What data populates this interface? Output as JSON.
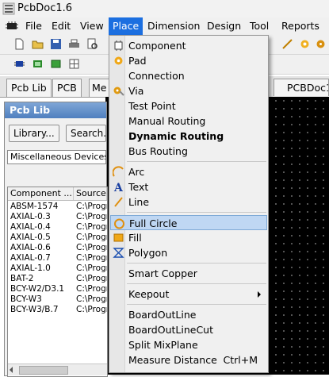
{
  "window": {
    "title": "PcbDoc1.6"
  },
  "menubar": {
    "items": [
      {
        "label": "File",
        "active": false
      },
      {
        "label": "Edit",
        "active": false
      },
      {
        "label": "View",
        "active": false
      },
      {
        "label": "Place",
        "active": true
      },
      {
        "label": "Dimension",
        "active": false
      },
      {
        "label": "Design",
        "active": false
      },
      {
        "label": "Tool",
        "active": false
      },
      {
        "label": "Reports",
        "active": false
      }
    ]
  },
  "doc_tabs": [
    {
      "label": "Pcb Lib"
    },
    {
      "label": "PCB"
    },
    {
      "label": "Me"
    }
  ],
  "editor_tab": {
    "label": "PCBDoc1"
  },
  "panel": {
    "title": "Pcb Lib",
    "library_button": "Library...",
    "search_button": "Search...",
    "library_select": "Miscellaneous Devices.pcl",
    "columns": [
      "Component ...",
      "Source"
    ],
    "rows": [
      {
        "name": "ABSM-1574",
        "source": "C:\\Progr"
      },
      {
        "name": "AXIAL-0.3",
        "source": "C:\\Progr"
      },
      {
        "name": "AXIAL-0.4",
        "source": "C:\\Progr"
      },
      {
        "name": "AXIAL-0.5",
        "source": "C:\\Progr"
      },
      {
        "name": "AXIAL-0.6",
        "source": "C:\\Progr"
      },
      {
        "name": "AXIAL-0.7",
        "source": "C:\\Progr"
      },
      {
        "name": "AXIAL-1.0",
        "source": "C:\\Progr"
      },
      {
        "name": "BAT-2",
        "source": "C:\\Progr"
      },
      {
        "name": "BCY-W2/D3.1",
        "source": "C:\\Progr"
      },
      {
        "name": "BCY-W3",
        "source": "C:\\Progr"
      },
      {
        "name": "BCY-W3/B.7",
        "source": "C:\\Progr"
      }
    ]
  },
  "place_menu": {
    "items": [
      {
        "label": "Component",
        "icon": "component-icon",
        "bold": false,
        "highlighted": false,
        "shortcut": "",
        "submenu": false
      },
      {
        "label": "Pad",
        "icon": "pad-icon",
        "bold": false,
        "highlighted": false,
        "shortcut": "",
        "submenu": false
      },
      {
        "label": "Connection",
        "icon": "",
        "bold": false,
        "highlighted": false,
        "shortcut": "",
        "submenu": false
      },
      {
        "label": "Via",
        "icon": "via-icon",
        "bold": false,
        "highlighted": false,
        "shortcut": "",
        "submenu": false
      },
      {
        "label": "Test Point",
        "icon": "",
        "bold": false,
        "highlighted": false,
        "shortcut": "",
        "submenu": false
      },
      {
        "label": "Manual Routing",
        "icon": "",
        "bold": false,
        "highlighted": false,
        "shortcut": "",
        "submenu": false
      },
      {
        "label": "Dynamic Routing",
        "icon": "",
        "bold": true,
        "highlighted": false,
        "shortcut": "",
        "submenu": false
      },
      {
        "label": "Bus Routing",
        "icon": "",
        "bold": false,
        "highlighted": false,
        "shortcut": "",
        "submenu": false
      },
      {
        "label": "Arc",
        "icon": "arc-icon",
        "bold": false,
        "highlighted": false,
        "shortcut": "",
        "submenu": false
      },
      {
        "label": "Text",
        "icon": "text-icon",
        "bold": false,
        "highlighted": false,
        "shortcut": "",
        "submenu": false
      },
      {
        "label": "Line",
        "icon": "line-icon",
        "bold": false,
        "highlighted": false,
        "shortcut": "",
        "submenu": false
      },
      {
        "label": "Full Circle",
        "icon": "full-circle-icon",
        "bold": false,
        "highlighted": true,
        "shortcut": "",
        "submenu": false
      },
      {
        "label": "Fill",
        "icon": "fill-icon",
        "bold": false,
        "highlighted": false,
        "shortcut": "",
        "submenu": false
      },
      {
        "label": "Polygon",
        "icon": "polygon-icon",
        "bold": false,
        "highlighted": false,
        "shortcut": "",
        "submenu": false
      },
      {
        "label": "Smart Copper",
        "icon": "",
        "bold": false,
        "highlighted": false,
        "shortcut": "",
        "submenu": false
      },
      {
        "label": "Keepout",
        "icon": "",
        "bold": false,
        "highlighted": false,
        "shortcut": "",
        "submenu": true
      },
      {
        "label": "BoardOutLine",
        "icon": "",
        "bold": false,
        "highlighted": false,
        "shortcut": "",
        "submenu": false
      },
      {
        "label": "BoardOutLineCut",
        "icon": "",
        "bold": false,
        "highlighted": false,
        "shortcut": "",
        "submenu": false
      },
      {
        "label": "Split MixPlane",
        "icon": "",
        "bold": false,
        "highlighted": false,
        "shortcut": "",
        "submenu": false
      },
      {
        "label": "Measure Distance",
        "icon": "",
        "bold": false,
        "highlighted": false,
        "shortcut": "Ctrl+M",
        "submenu": false
      }
    ]
  },
  "colors": {
    "accent": "#1c6fe0",
    "highlight": "#bfd7f3",
    "canvas": "#000000",
    "panel_header": "#4f7fbf"
  }
}
